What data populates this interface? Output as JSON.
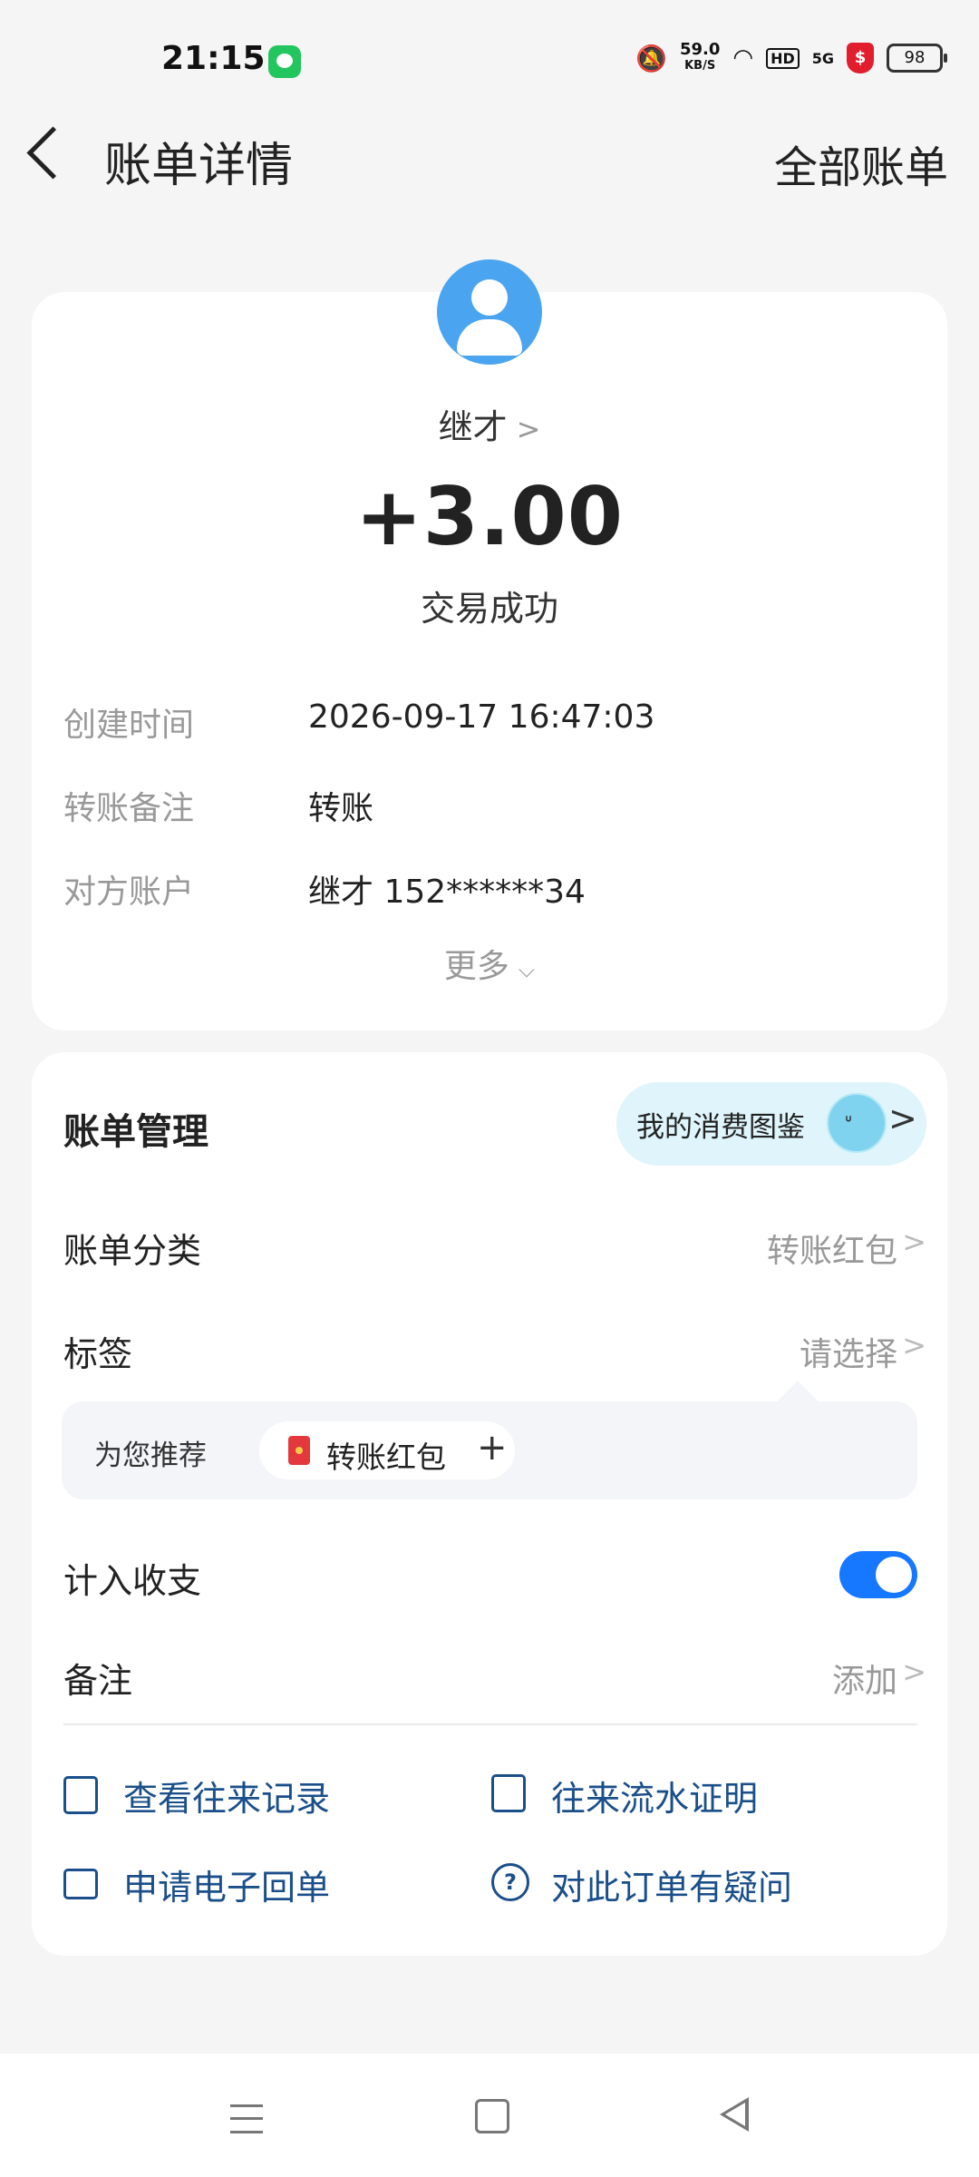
{
  "status_bar": {
    "time": "21:15",
    "net_speed_value": "59.0",
    "net_speed_unit": "KB/S",
    "hd": "HD",
    "signal": "5G",
    "battery": "98"
  },
  "header": {
    "title": "账单详情",
    "right_link": "全部账单"
  },
  "bill": {
    "payee": "继才",
    "amount": "+3.00",
    "status": "交易成功",
    "details": [
      {
        "label": "创建时间",
        "value": "2026-09-17 16:47:03"
      },
      {
        "label": "转账备注",
        "value": "转账"
      },
      {
        "label": "对方账户",
        "value": "继才 152******34"
      }
    ],
    "more": "更多"
  },
  "management": {
    "title": "账单管理",
    "gallery_button": "我的消费图鉴",
    "category_label": "账单分类",
    "category_value": "转账红包",
    "tag_label": "标签",
    "tag_value": "请选择",
    "recommend_label": "为您推荐",
    "recommend_chip": "转账红包",
    "income_expense_label": "计入收支",
    "income_expense_on": true,
    "note_label": "备注",
    "note_value": "添加",
    "links": [
      "查看往来记录",
      "往来流水证明",
      "申请电子回单",
      "对此订单有疑问"
    ]
  },
  "colors": {
    "accent": "#1677ff",
    "link": "#1b4f8a",
    "avatar": "#4aa4ef"
  }
}
